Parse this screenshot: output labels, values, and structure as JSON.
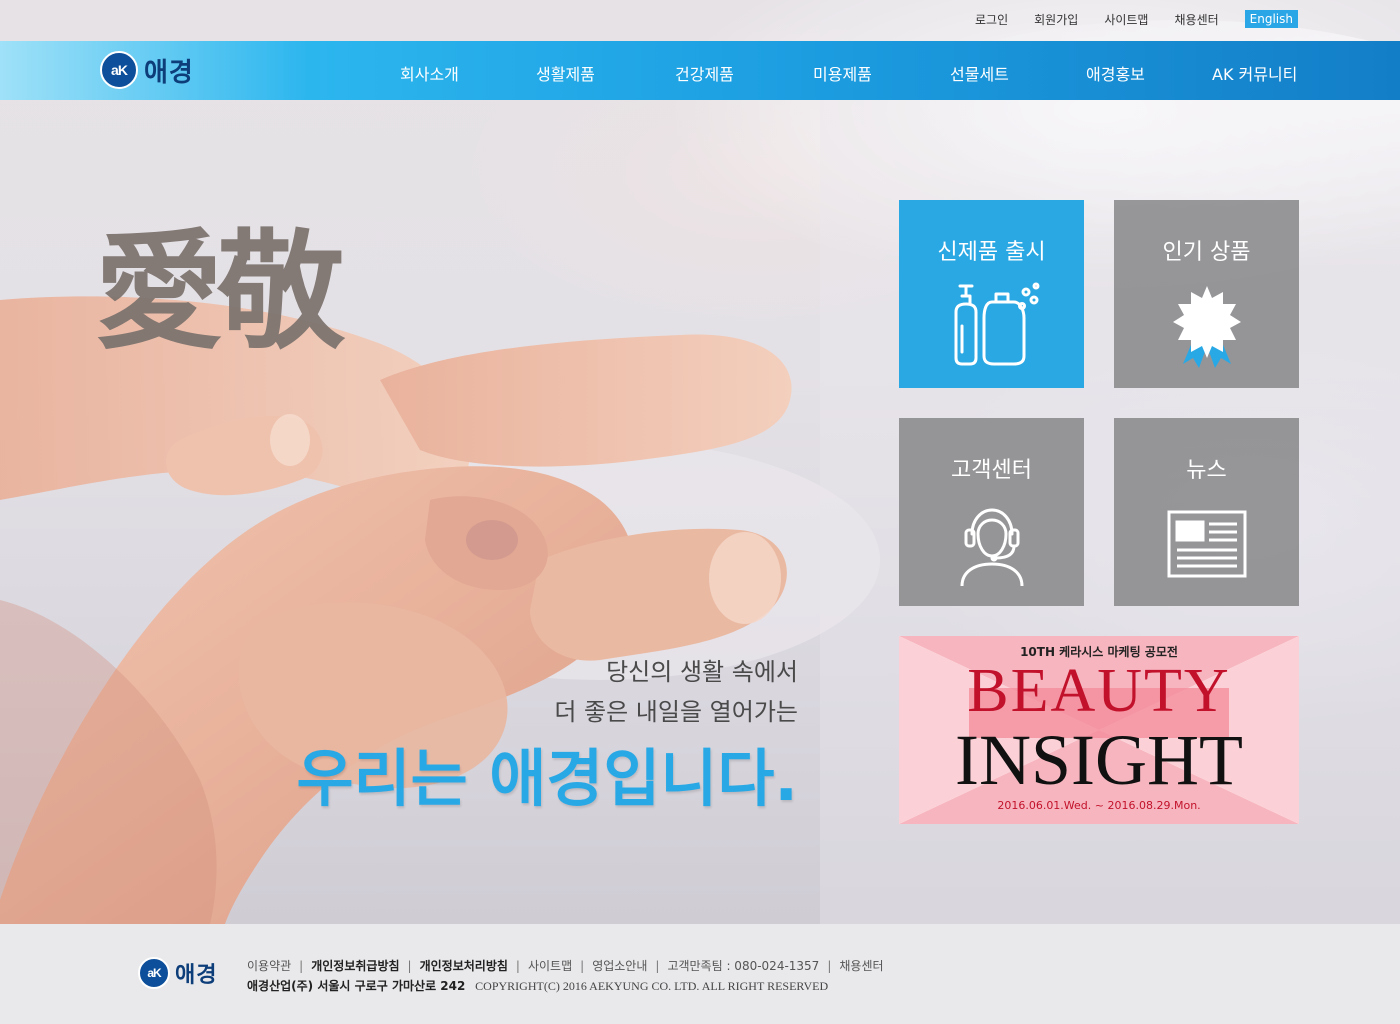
{
  "header": {
    "util_links": [
      "로그인",
      "회원가입",
      "사이트맵",
      "채용센터"
    ],
    "lang_button": "English",
    "logo_mark": "aK",
    "logo_text": "애경",
    "menu": [
      "회사소개",
      "생활제품",
      "건강제품",
      "미용제품",
      "선물세트",
      "애경홍보",
      "AK 커뮤니티"
    ]
  },
  "hero": {
    "hanja": "愛敬",
    "slogan_line1": "당신의 생활 속에서",
    "slogan_line2": "더 좋은 내일을 열어가는",
    "slogan_main": "우리는 애경입니다."
  },
  "tiles": [
    {
      "label": "신제품 출시",
      "icon": "bottles-icon"
    },
    {
      "label": "인기 상품",
      "icon": "award-badge-icon"
    },
    {
      "label": "고객센터",
      "icon": "headset-agent-icon"
    },
    {
      "label": "뉴스",
      "icon": "newspaper-icon"
    }
  ],
  "banner": {
    "top_text": "10TH 케라시스 마케팅 공모전",
    "title1": "BEAUTY",
    "title2": "INSIGHT",
    "dates": "2016.06.01.Wed. ~ 2016.08.29.Mon."
  },
  "footer": {
    "logo_text": "애경",
    "links": [
      "이용약관",
      "개인정보취급방침",
      "개인정보처리방침",
      "사이트맵",
      "영업소안내",
      "고객만족팀 : 080-024-1357",
      "채용센터"
    ],
    "company": "애경산업(주)  서울시 구로구 가마산로 242",
    "copyright": "COPYRIGHT(C) 2016 AEKYUNG CO. LTD. ALL RIGHT RESERVED"
  },
  "colors": {
    "accent": "#29a8e4",
    "nav_dark": "#137ec8",
    "tile_gray": "#8a8a8c",
    "banner_red": "#c2122b",
    "banner_pink": "#f7a8b3"
  }
}
